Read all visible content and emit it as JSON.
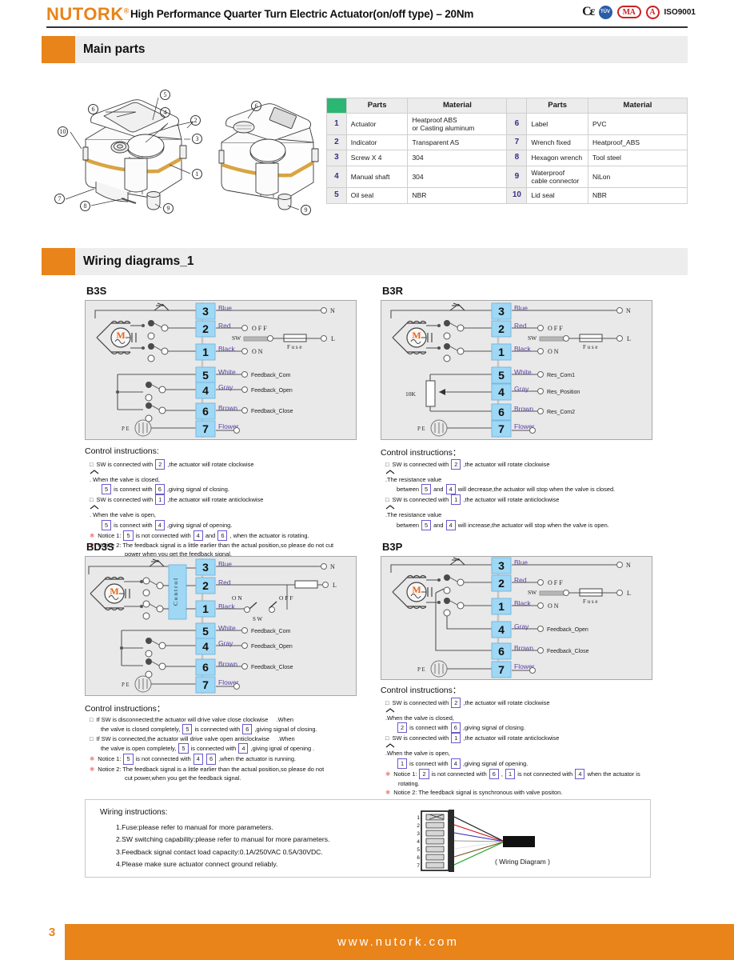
{
  "header": {
    "brand": "NUTORK",
    "brand_reg": "®",
    "title": "High Performance Quarter Turn Electric Actuator(on/off type) – 20Nm",
    "certs": [
      "CE",
      "TUV",
      "MA",
      "A",
      "ISO9001"
    ],
    "iso_label": "ISO9001"
  },
  "sections": {
    "main_parts": "Main parts",
    "wiring_diagrams": "Wiring diagrams_1"
  },
  "parts_table": {
    "headers": [
      "",
      "Parts",
      "Material",
      "",
      "Parts",
      "Material"
    ],
    "rows": [
      {
        "n1": "1",
        "p1": "Actuator",
        "m1": "Heatproof ABS\nor  Casting aluminum",
        "n2": "6",
        "p2": "Label",
        "m2": "PVC"
      },
      {
        "n1": "2",
        "p1": "Indicator",
        "m1": "Transparent AS",
        "n2": "7",
        "p2": "Wrench fixed",
        "m2": "Heatproof_ABS"
      },
      {
        "n1": "3",
        "p1": "Screw X 4",
        "m1": "304",
        "n2": "8",
        "p2": "Hexagon wrench",
        "m2": "Tool steel"
      },
      {
        "n1": "4",
        "p1": "Manual shaft",
        "m1": "304",
        "n2": "9",
        "p2": "Waterproof\ncable connector",
        "m2": "NiLon"
      },
      {
        "n1": "5",
        "p1": "Oil seal",
        "m1": "NBR",
        "n2": "10",
        "p2": "Lid seal",
        "m2": "NBR"
      }
    ]
  },
  "illustration": {
    "callouts_left": [
      "5",
      "6",
      "4",
      "2",
      "3",
      "10",
      "1",
      "7",
      "8",
      "9"
    ],
    "callouts_right": [
      "6",
      "9"
    ]
  },
  "diagrams": {
    "b3s": {
      "label": "B3S",
      "terminals": [
        {
          "no": "3",
          "wire": "Blue",
          "right": "N"
        },
        {
          "no": "2",
          "wire": "Red",
          "right": "O F F"
        },
        {
          "no": "1",
          "wire": "Black",
          "right": "O N"
        },
        {
          "no": "5",
          "wire": "White",
          "right": "Feedback_Com"
        },
        {
          "no": "4",
          "wire": "Gray",
          "right": "Feedback_Open"
        },
        {
          "no": "6",
          "wire": "Brown",
          "right": "Feedback_Close"
        },
        {
          "no": "7",
          "wire": "Flower",
          "right": ""
        }
      ],
      "sw_label": "SW",
      "fuse_label": "F u s e",
      "line_label": "L",
      "pe_label": "P E",
      "motor_label": "M",
      "ci_title": "Control instructions:",
      "instructions": [
        {
          "type": "box",
          "parts": [
            "SW is connected with ",
            "2",
            " ,the actuator will rotate clockwise ⌒ . When the valve is closed,"
          ],
          "cont": [
            "5",
            " is connect with ",
            "6",
            " ,giving signal of closing."
          ]
        },
        {
          "type": "box",
          "parts": [
            "SW is connected with ",
            "1",
            " ,the actuator will rotate anticlockwise ⌓. When the valve is open,"
          ],
          "cont": [
            "5",
            " is connect with ",
            "4",
            " ,giving signal of opening."
          ]
        },
        {
          "type": "star",
          "parts": [
            "Notice 1: ",
            "5",
            " is not connected with ",
            "4",
            " and ",
            "6",
            " , when the actuator is rotating."
          ]
        },
        {
          "type": "star",
          "parts": [
            "Notice 2: The feedback signal is a little earlier than the actual position,so please do not cut"
          ],
          "cont2": "power when you get the feedback signal."
        }
      ]
    },
    "b3r": {
      "label": "B3R",
      "terminals": [
        {
          "no": "3",
          "wire": "Blue",
          "right": "N"
        },
        {
          "no": "2",
          "wire": "Red",
          "right": "O F F"
        },
        {
          "no": "1",
          "wire": "Black",
          "right": "O N"
        },
        {
          "no": "5",
          "wire": "White",
          "right": "Res_Com1"
        },
        {
          "no": "4",
          "wire": "Gray",
          "right": "Res_Position"
        },
        {
          "no": "6",
          "wire": "Brown",
          "right": "Res_Com2"
        },
        {
          "no": "7",
          "wire": "Flower",
          "right": ""
        }
      ],
      "pot_label": "10K",
      "sw_label": "SW",
      "fuse_label": "F u s e",
      "line_label": "L",
      "pe_label": "P E",
      "motor_label": "M",
      "ci_title": "Control instructions：",
      "instructions": [
        {
          "type": "box",
          "parts": [
            "SW is connected with ",
            "2",
            " ,the actuator will rotate clockwise ⌒ .The resistance value"
          ],
          "cont": [
            "between ",
            "5",
            " and ",
            "4",
            " will decrease,the actuator will stop when the valve is closed."
          ]
        },
        {
          "type": "box",
          "parts": [
            "SW is connected with ",
            "1",
            " ,the actuator will rotate anticlockwise ⌓.The resistance value"
          ],
          "cont": [
            "between ",
            "5",
            " and ",
            "4",
            " will increase,the actuator will stop when the valve is open."
          ]
        }
      ]
    },
    "bd3s": {
      "label": "BD3S",
      "terminals": [
        {
          "no": "3",
          "wire": "Blue",
          "right": "N"
        },
        {
          "no": "2",
          "wire": "Red",
          "right": ""
        },
        {
          "no": "1",
          "wire": "Black",
          "right": ""
        },
        {
          "no": "5",
          "wire": "White",
          "right": "Feedback_Com"
        },
        {
          "no": "4",
          "wire": "Gray",
          "right": "Feedback_Open"
        },
        {
          "no": "6",
          "wire": "Brown",
          "right": "Feedback_Close"
        },
        {
          "no": "7",
          "wire": "Flower",
          "right": ""
        }
      ],
      "control_block": "C o n t r o l",
      "on_label": "O N",
      "off_label": "O F F",
      "sw_label": "S W",
      "line_label": "L",
      "pe_label": "P E",
      "motor_label": "M",
      "ci_title": "Control instructions：",
      "instructions": [
        {
          "type": "box",
          "parts": [
            "If SW is disconnected;the actuator will drive valve close clockwise      .When"
          ],
          "cont": [
            "the valve is closed completely, ",
            "5",
            " is connected with ",
            "6",
            " ,giving signal of closing."
          ]
        },
        {
          "type": "box",
          "parts": [
            "If SW is connected,the actuator will drive valve open anticlockwise       .When"
          ],
          "cont": [
            "the valve is open completely,  ",
            "5",
            " is connected with ",
            "4",
            " ,giving ignal of opening ."
          ]
        },
        {
          "type": "star",
          "parts": [
            "Notice 1: ",
            "5",
            " is not connected with ",
            "4",
            "  ",
            "6",
            " ,when the actuator is running."
          ]
        },
        {
          "type": "star",
          "parts": [
            "Notice 2: The feedback signal is a little earlier than the actual position,so please do not"
          ],
          "cont2": "cut power,when you get the feedback signal."
        }
      ]
    },
    "b3p": {
      "label": "B3P",
      "terminals": [
        {
          "no": "3",
          "wire": "Blue",
          "right": "N"
        },
        {
          "no": "2",
          "wire": "Red",
          "right": "O F F"
        },
        {
          "no": "1",
          "wire": "Black",
          "right": "O N"
        },
        {
          "no": "4",
          "wire": "Gray",
          "right": "Feedback_Open"
        },
        {
          "no": "6",
          "wire": "Brown",
          "right": "Feedback_Close"
        },
        {
          "no": "7",
          "wire": "Flower",
          "right": ""
        }
      ],
      "sw_label": "S W",
      "fuse_label": "F u s e",
      "line_label": "L",
      "pe_label": "P E",
      "motor_label": "M",
      "ci_title": "Control instructions：",
      "instructions": [
        {
          "type": "box",
          "parts": [
            "SW is connected with ",
            "2",
            " ,the actuator will rotate clockwise ⌒ .When the valve is closed,"
          ],
          "cont": [
            "2",
            " is connect with ",
            "6",
            " ,giving signal of closing."
          ]
        },
        {
          "type": "box",
          "parts": [
            "SW is connected with ",
            "1",
            " ,the actuator will rotate anticlockwise ⌓.When the valve is open,"
          ],
          "cont": [
            "1",
            " is connect with ",
            "4",
            " ,giving signal of opening."
          ]
        },
        {
          "type": "star",
          "parts": [
            "Notice 1: ",
            "2",
            " is not connected with ",
            "6",
            " , ",
            "1",
            " is not connected with ",
            "4",
            " when the actuator is"
          ],
          "cont2": "rotating."
        },
        {
          "type": "star",
          "parts": [
            "Notice 2: The feedback signal is synchronous with valve positon."
          ]
        }
      ]
    }
  },
  "wiring_instructions": {
    "title": "Wiring instructions:",
    "items": [
      "1.Fuse:please refer to manual for more parameters.",
      "2.SW switching capability:please refer to manual for more parameters.",
      "3.Feedback signal contact load capacity:0.1A/250VAC 0.5A/30VDC.",
      "4.Please make sure actuator connect ground reliably."
    ],
    "connector_pins": [
      "1",
      "2",
      "3",
      "4",
      "5",
      "6",
      "7"
    ],
    "connector_caption": "( Wiring Diagram )"
  },
  "footer": {
    "page_number": "3",
    "url": "www.nutork.com"
  },
  "colors": {
    "brand_orange": "#E8841A",
    "terminal_blue": "#9ED8F5",
    "wire_purple": "#5B3FA8",
    "green_cell": "#2BB673"
  }
}
